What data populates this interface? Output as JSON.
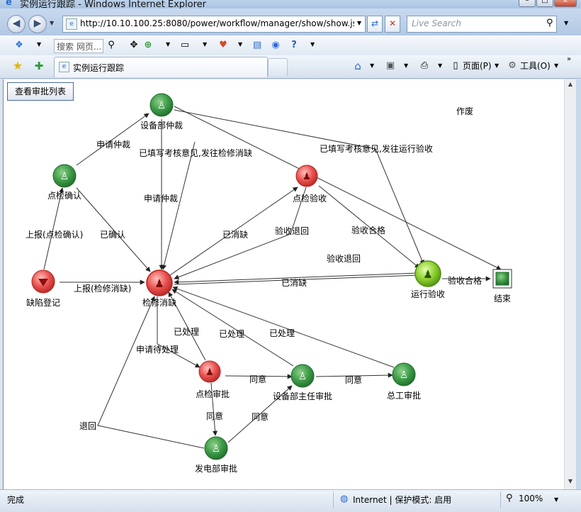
{
  "window": {
    "title": "实例运行跟踪 - Windows Internet Explorer"
  },
  "address_bar": {
    "url": "http://10.10.100.25:8080/power/workflow/manager/show/show.jsp"
  },
  "search": {
    "placeholder": "Live Search"
  },
  "toolbar": {
    "search_placeholder": "搜索 网页..."
  },
  "tab": {
    "title": "实例运行跟踪"
  },
  "commands": {
    "page": "页面(P)",
    "tools": "工具(O)"
  },
  "content": {
    "view_list_button": "查看审批列表",
    "colors": {
      "green": "#3e9b48",
      "red": "#e8514f",
      "lime": "#8ccf2e",
      "edge": "#333333"
    },
    "nodes": {
      "sbzc": "设备部仲裁",
      "djqr": "点检确认",
      "djys": "点检验收",
      "qxdj": "缺陷登记",
      "jxxq": "检修消缺",
      "yxys": "运行验收",
      "end": "结束",
      "djsp": "点检审批",
      "sbbzr": "设备部主任审批",
      "zgsp": "总工审批",
      "fdbsp": "发电部审批"
    },
    "edges": {
      "zuofei": "作废",
      "sqzc1": "申请仲裁",
      "ytxkh1": "已填写考核意见,发往检修消缺",
      "ytxkh2": "已填写考核意见,发往运行验收",
      "sqzc2": "申请仲裁",
      "sbdjqr": "上报(点检确认)",
      "yqr": "已确认",
      "yxq1": "已消缺",
      "ysth1": "验收退回",
      "yshg1": "验收合格",
      "ysth2": "验收退回",
      "yshg2": "验收合格",
      "sbjxxq": "上报(检修消缺)",
      "yxq2": "已消缺",
      "ycl1": "已处理",
      "ycl2": "已处理",
      "ycl3": "已处理",
      "sqdcl": "申请待处理",
      "ty1": "同意",
      "ty2": "同意",
      "ty3": "同意",
      "ty4": "同意",
      "tuihui": "退回"
    }
  },
  "status": {
    "done": "完成",
    "zone": "Internet | 保护模式: 启用",
    "zoom": "100%"
  }
}
